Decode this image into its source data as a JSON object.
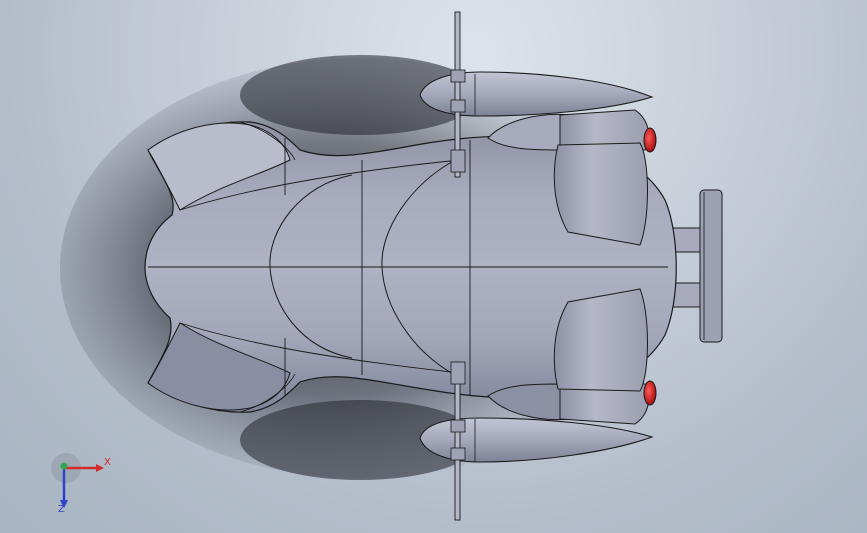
{
  "triad": {
    "x_label": "X",
    "z_label": "Z",
    "x_color": "#d42b2b",
    "y_color": "#2fa84f",
    "z_color": "#2e44c8"
  },
  "model": {
    "body_color": "#9ea2b4",
    "edge_color": "#1a1a1a",
    "light_color": "#cc1a1a"
  }
}
